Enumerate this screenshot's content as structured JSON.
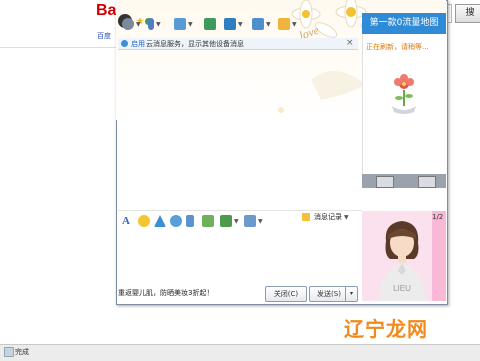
{
  "browser": {
    "logo_text": "Ba",
    "link_text": "百度",
    "search_button": "搜",
    "status_text": "完成"
  },
  "chat": {
    "notice_link": "启用",
    "notice_text": "云消息服务，显示其他设备消息",
    "notice_close": "×",
    "input_toolbar": {
      "record_label": "消息记录"
    },
    "ad_line": "重返婴儿肌，防晒美妆3折起！",
    "close_label": "关闭(C)",
    "send_label": "发送(S)",
    "send_arrow": "▾",
    "avatar_counter": "1/2",
    "avatar_shirt_text": "LIEU"
  },
  "ad_panel": {
    "title": "第一款0流量地图",
    "loading": "正在刷新，请稍等..."
  },
  "watermark": "辽宁龙网",
  "colors": {
    "accent": "#2f8bd6",
    "loading": "#e07800",
    "watermark": "#f18a1c"
  },
  "icons": [
    "user-avatar-icon",
    "star-icon",
    "microphone-icon",
    "screen-icon",
    "app-icon",
    "transfer-icon",
    "remote-icon",
    "more-icon",
    "font-icon",
    "emoji-icon",
    "shake-icon",
    "scrawl-icon",
    "voice-icon",
    "screenshot-icon",
    "image-icon",
    "music-icon",
    "record-icon"
  ]
}
